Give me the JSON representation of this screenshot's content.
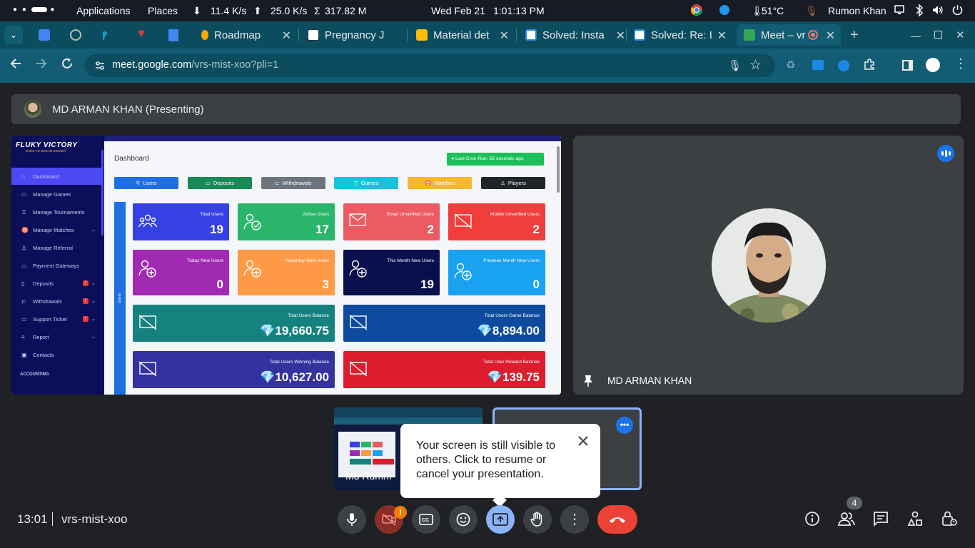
{
  "system_bar": {
    "menu_applications": "Applications",
    "menu_places": "Places",
    "down_speed": "11.4 K/s",
    "up_speed": "25.0 K/s",
    "memory": "317.82 M",
    "date": "Wed Feb 21",
    "time": "1:01:13 PM",
    "temperature": "51°C",
    "user": "Rumon Khan"
  },
  "tabs": [
    {
      "label": "Roadmap",
      "color": "#f9ab00"
    },
    {
      "label": "Pregnancy J",
      "color": "#ffffff"
    },
    {
      "label": "Material det",
      "color": "#fbbc04"
    },
    {
      "label": "Solved: Insta",
      "color": "#1e88e5"
    },
    {
      "label": "Solved: Re: I",
      "color": "#1e88e5"
    },
    {
      "label": "Meet – vr",
      "color": "#34a853"
    }
  ],
  "address_bar": {
    "host": "meet.google.com",
    "path": "/vrs-mist-xoo?pli=1"
  },
  "meet": {
    "presenter_banner": "MD ARMAN KHAN (Presenting)",
    "tile_name": "MD ARMAN KHAN",
    "thumb_name": "Md Rumm",
    "tooltip_text": "Your screen is still visible to others. Click to resume or cancel your presentation.",
    "clock": "13:01",
    "meeting_code": "vrs-mist-xoo",
    "participant_count": "4",
    "camera_alert": "!"
  },
  "shared_screen": {
    "brand_name": "FLUKY VICTORY",
    "brand_tagline": "DARE TO DREAM BIGGER",
    "sidebar": [
      {
        "label": "Dashboard",
        "icon": "home-icon"
      },
      {
        "label": "Manage Games",
        "icon": "gamepad-icon"
      },
      {
        "label": "Manage Tournaments",
        "icon": "trophy-icon"
      },
      {
        "label": "Manage Matches",
        "icon": "medal-icon"
      },
      {
        "label": "Manage Referral",
        "icon": "bell-icon"
      },
      {
        "label": "Payment Gateways",
        "icon": "card-icon"
      },
      {
        "label": "Deposits",
        "icon": "wallet-icon"
      },
      {
        "label": "Withdrawals",
        "icon": "bank-icon"
      },
      {
        "label": "Support Ticket",
        "icon": "ticket-icon"
      },
      {
        "label": "Report",
        "icon": "list-icon"
      },
      {
        "label": "Contacts",
        "icon": "contact-icon"
      }
    ],
    "section_label": "ACCOUNTING",
    "page_title": "Dashboard",
    "cron_badge": "Last Cron Run: 55 seconds ago",
    "quick_buttons": [
      {
        "label": "Users",
        "color": "#1e6fe0"
      },
      {
        "label": "Deposits",
        "color": "#178a55"
      },
      {
        "label": "Withdrawals",
        "color": "#6c757d"
      },
      {
        "label": "Games",
        "color": "#17c3dc"
      },
      {
        "label": "Matches",
        "color": "#f5b82e"
      },
      {
        "label": "Players",
        "color": "#212529"
      }
    ],
    "users_vertical_label": "Users",
    "cards": [
      {
        "title": "Total Users",
        "value": "19",
        "color": "#3541e5"
      },
      {
        "title": "Active Users",
        "value": "17",
        "color": "#2ab66a"
      },
      {
        "title": "Email Unverified Users",
        "value": "2",
        "color": "#ec5a62"
      },
      {
        "title": "Mobile Unverified Users",
        "value": "2",
        "color": "#ef3e3b"
      },
      {
        "title": "Today New Users",
        "value": "0",
        "color": "#a12ab3"
      },
      {
        "title": "Yesterday New Users",
        "value": "3",
        "color": "#fe9a45"
      },
      {
        "title": "This Month New Users",
        "value": "19",
        "color": "#0a0f4e"
      },
      {
        "title": "Previous Month New Users",
        "value": "0",
        "color": "#18a2f0"
      },
      {
        "title": "Total Users Balance",
        "value": "19,660.75",
        "color": "#16827f"
      },
      {
        "title": "Total Users Game Balance",
        "value": "8,894.00",
        "color": "#0d4b9e"
      },
      {
        "title": "Total Users Winning Balance",
        "value": "10,627.00",
        "color": "#34329f"
      },
      {
        "title": "Total User Reward Balance",
        "value": "139.75",
        "color": "#dd1c2e"
      }
    ]
  },
  "colors": {
    "end_call": "#ea4335",
    "accent_blue": "#1a73e8",
    "alert_orange": "#f57c00"
  }
}
